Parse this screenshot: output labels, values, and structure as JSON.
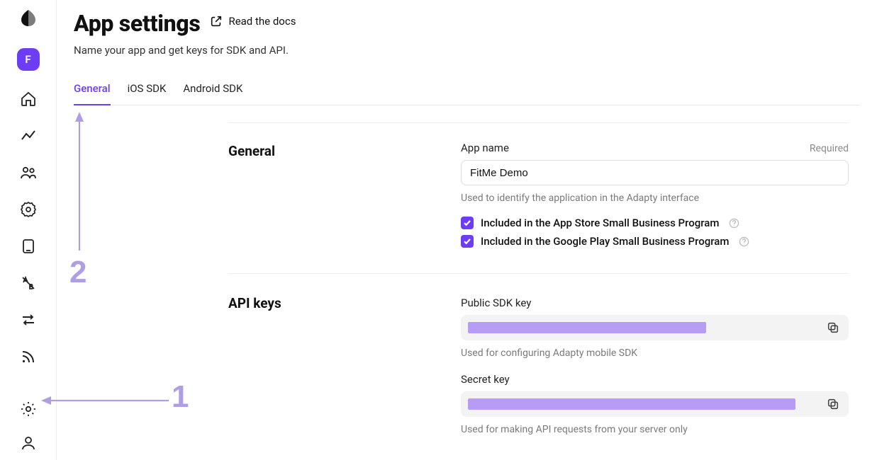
{
  "sidebar": {
    "avatar_letter": "F"
  },
  "header": {
    "title": "App settings",
    "docs_label": "Read the docs",
    "subtitle": "Name your app and get keys for SDK and API."
  },
  "tabs": [
    {
      "label": "General",
      "active": true
    },
    {
      "label": "iOS SDK",
      "active": false
    },
    {
      "label": "Android SDK",
      "active": false
    }
  ],
  "sections": {
    "general": {
      "title": "General",
      "app_name_label": "App name",
      "required_label": "Required",
      "app_name_value": "FitMe Demo",
      "app_name_hint": "Used to identify the application in the Adapty interface",
      "checkbox_app_store": "Included in the App Store Small Business Program",
      "checkbox_google_play": "Included in the Google Play Small Business Program"
    },
    "api_keys": {
      "title": "API keys",
      "public_label": "Public SDK key",
      "public_hint": "Used for configuring Adapty mobile SDK",
      "secret_label": "Secret key",
      "secret_hint": "Used for making API requests from your server only"
    }
  },
  "annotations": {
    "one": "1",
    "two": "2"
  }
}
